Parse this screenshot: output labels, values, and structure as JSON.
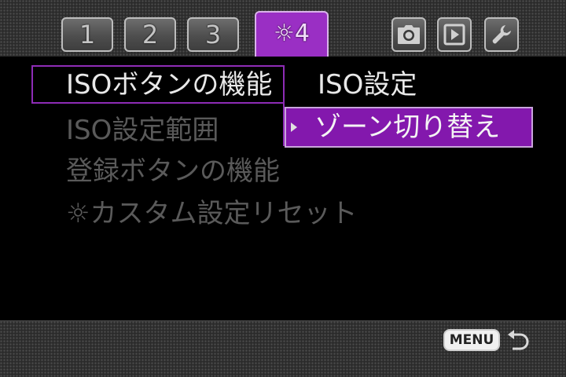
{
  "tabs": [
    {
      "label": "1"
    },
    {
      "label": "2"
    },
    {
      "label": "3"
    },
    {
      "label": "☼4"
    }
  ],
  "mode_tabs": [
    {
      "icon": "camera-icon"
    },
    {
      "icon": "playback-icon"
    },
    {
      "icon": "wrench-icon"
    }
  ],
  "menu": {
    "items": [
      {
        "label": "ISOボタンの機能"
      },
      {
        "label": "ISO設定範囲"
      },
      {
        "label": "登録ボタンの機能"
      },
      {
        "label": "☼カスタム設定リセット"
      }
    ]
  },
  "submenu": {
    "options": [
      {
        "label": "ISO設定"
      },
      {
        "label": "ゾーン切り替え"
      }
    ]
  },
  "footer": {
    "menu_label": "MENU",
    "back_icon": "return-arrow-icon"
  },
  "colors": {
    "accent": "#8e2cb6",
    "highlight": "#8318ad",
    "active_text": "#e8e8e8",
    "inactive_text": "#5a5a5a"
  }
}
